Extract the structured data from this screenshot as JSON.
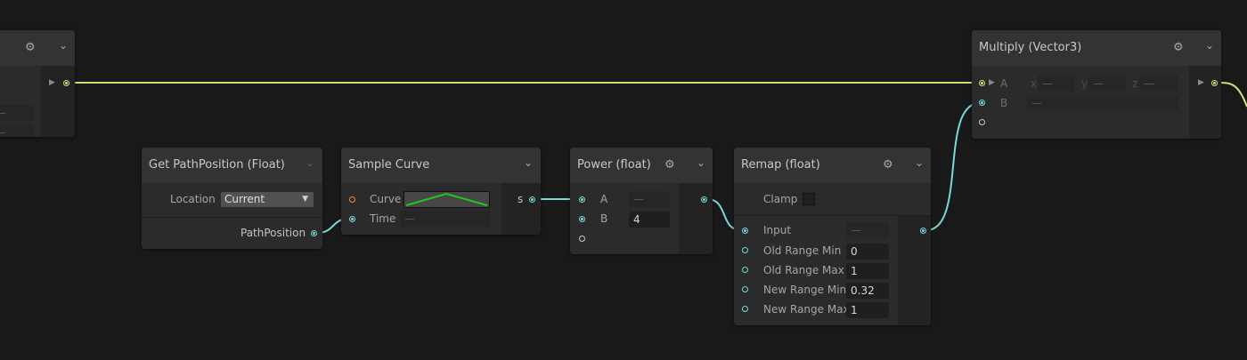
{
  "nodes": {
    "left_partial": {
      "input_placeholder_1": "—",
      "input_placeholder_2": "—"
    },
    "get_path_position": {
      "title": "Get PathPosition (Float)",
      "location_label": "Location",
      "location_value": "Current",
      "output_label": "PathPosition"
    },
    "sample_curve": {
      "title": "Sample Curve",
      "curve_label": "Curve",
      "time_label": "Time",
      "time_placeholder": "—",
      "output_label": "s"
    },
    "power": {
      "title": "Power (float)",
      "a_label": "A",
      "a_placeholder": "—",
      "b_label": "B",
      "b_value": "4"
    },
    "remap": {
      "title": "Remap (float)",
      "clamp_label": "Clamp",
      "input_label": "Input",
      "input_placeholder": "—",
      "old_range_min_label": "Old Range Min",
      "old_range_min_value": "0",
      "old_range_max_label": "Old Range Max",
      "old_range_max_value": "1",
      "new_range_min_label": "New Range Min",
      "new_range_min_value": "0.32",
      "new_range_max_label": "New Range Max",
      "new_range_max_value": "1"
    },
    "multiply": {
      "title": "Multiply (Vector3)",
      "a_label": "A",
      "ax_label": "x",
      "ay_label": "y",
      "az_label": "z",
      "a_placeholder": "—",
      "b_label": "B",
      "b_placeholder": "—"
    }
  },
  "colors": {
    "background": "#191919",
    "float_wire": "#7ad8d8",
    "vector3_wire": "#d4e06e",
    "curve_line": "#1ec81e"
  },
  "icons": {
    "settings": "gear-icon",
    "collapse": "chevron-down-icon",
    "expand": "triangle-right-icon"
  }
}
